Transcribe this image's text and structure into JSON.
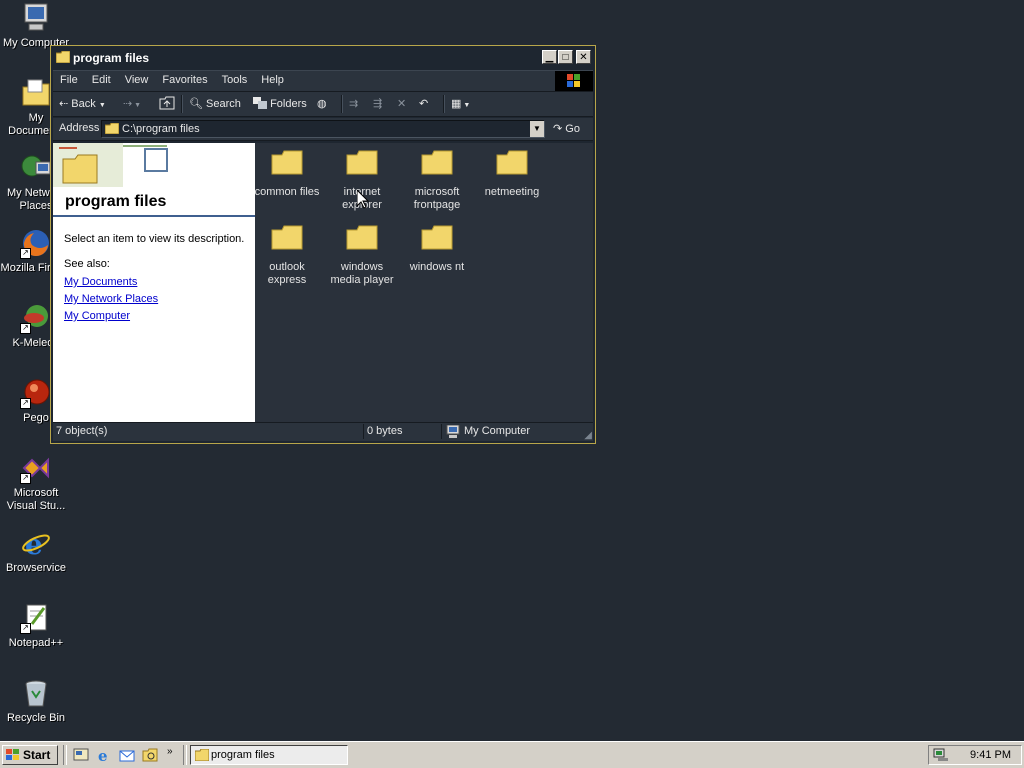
{
  "desktop": {
    "icons": [
      {
        "label": "My Computer"
      },
      {
        "label": "My Documents"
      },
      {
        "label": "My Network Places"
      },
      {
        "label": "Mozilla Firefox"
      },
      {
        "label": "K-Meleon"
      },
      {
        "label": "Pego"
      },
      {
        "label": "Microsoft Visual Stu..."
      },
      {
        "label": "Browservice"
      },
      {
        "label": "Notepad++"
      },
      {
        "label": "Recycle Bin"
      }
    ]
  },
  "window": {
    "title": "program files",
    "menu": [
      "File",
      "Edit",
      "View",
      "Favorites",
      "Tools",
      "Help"
    ],
    "toolbar": {
      "back_label": "Back",
      "search_label": "Search",
      "folders_label": "Folders"
    },
    "address": {
      "label": "Address",
      "value": "C:\\program files",
      "go_label": "Go"
    },
    "left_pane": {
      "title": "program files",
      "description": "Select an item to view its description.",
      "see_also": "See also:",
      "links": [
        "My Documents",
        "My Network Places",
        "My Computer"
      ]
    },
    "files": [
      {
        "line1": "common files",
        "line2": ""
      },
      {
        "line1": "internet",
        "line2": "explorer"
      },
      {
        "line1": "microsoft",
        "line2": "frontpage"
      },
      {
        "line1": "netmeeting",
        "line2": ""
      },
      {
        "line1": "outlook",
        "line2": "express"
      },
      {
        "line1": "windows",
        "line2": "media player"
      },
      {
        "line1": "windows nt",
        "line2": ""
      }
    ],
    "status": {
      "objects": "7 object(s)",
      "size": "0 bytes",
      "zone": "My Computer"
    }
  },
  "taskbar": {
    "start_label": "Start",
    "task_label": "program files",
    "clock": "9:41 PM"
  },
  "colors": {
    "desktop_bg": "#232a33",
    "window_border": "#b8a64a",
    "folder_yellow": "#f2d66b",
    "link_blue": "#0000cc"
  }
}
